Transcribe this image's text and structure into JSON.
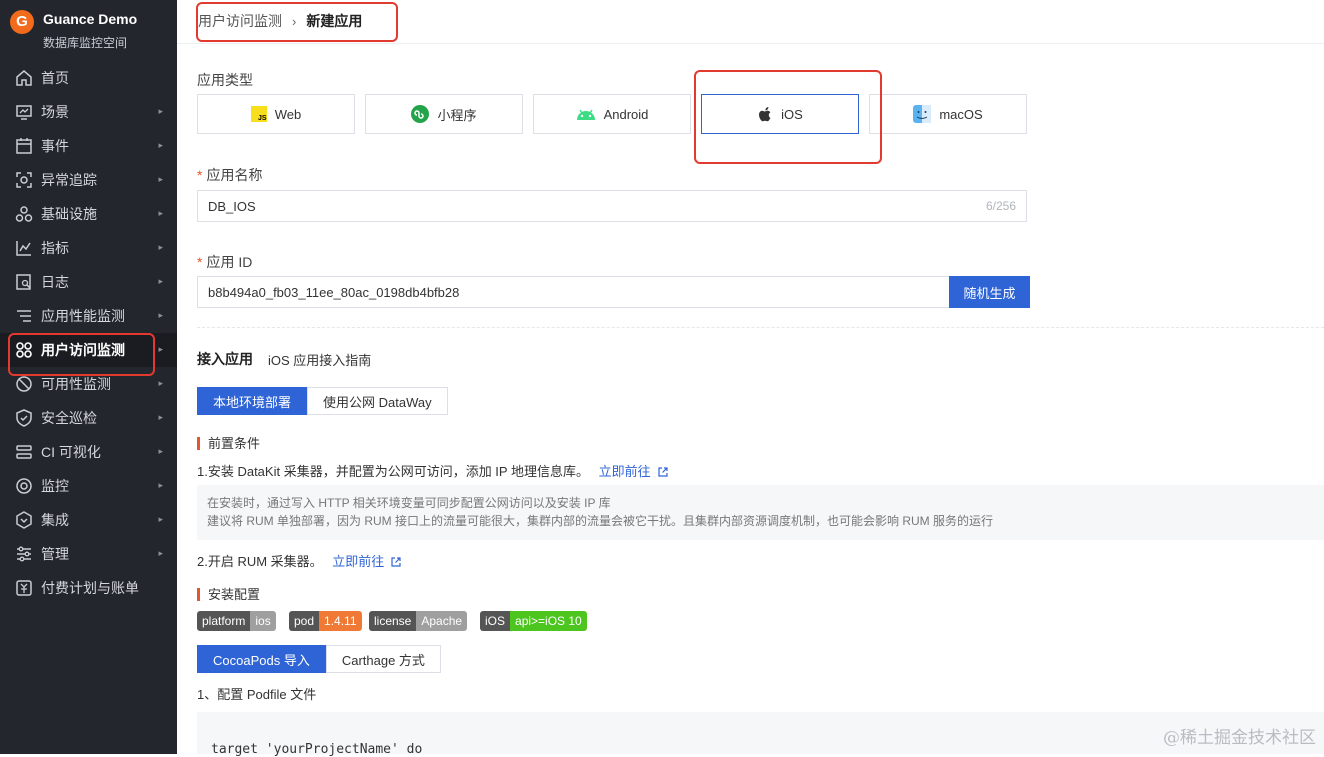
{
  "workspace": {
    "name": "Guance Demo",
    "subtitle": "数据库监控空间",
    "logo_letter": "G"
  },
  "sidebar": {
    "items": [
      {
        "label": "首页",
        "icon": "home-icon",
        "has_submenu": false
      },
      {
        "label": "场景",
        "icon": "dashboard-icon",
        "has_submenu": true
      },
      {
        "label": "事件",
        "icon": "calendar-icon",
        "has_submenu": true
      },
      {
        "label": "异常追踪",
        "icon": "scan-icon",
        "has_submenu": true
      },
      {
        "label": "基础设施",
        "icon": "cluster-icon",
        "has_submenu": true
      },
      {
        "label": "指标",
        "icon": "chart-icon",
        "has_submenu": true
      },
      {
        "label": "日志",
        "icon": "log-icon",
        "has_submenu": true
      },
      {
        "label": "应用性能监测",
        "icon": "apm-icon",
        "has_submenu": true
      },
      {
        "label": "用户访问监测",
        "icon": "grid-icon",
        "has_submenu": true,
        "active": true
      },
      {
        "label": "可用性监测",
        "icon": "gauge-icon",
        "has_submenu": true
      },
      {
        "label": "安全巡检",
        "icon": "shield-icon",
        "has_submenu": true
      },
      {
        "label": "CI 可视化",
        "icon": "ci-icon",
        "has_submenu": true
      },
      {
        "label": "监控",
        "icon": "monitor-icon",
        "has_submenu": true
      },
      {
        "label": "集成",
        "icon": "integration-icon",
        "has_submenu": true
      },
      {
        "label": "管理",
        "icon": "settings-icon",
        "has_submenu": true
      },
      {
        "label": "付费计划与账单",
        "icon": "billing-icon",
        "has_submenu": false
      }
    ]
  },
  "breadcrumb": {
    "parent": "用户访问监测",
    "separator": "›",
    "current": "新建应用"
  },
  "form": {
    "app_type_label": "应用类型",
    "app_types": [
      {
        "label": "Web",
        "icon": "js-icon"
      },
      {
        "label": "小程序",
        "icon": "miniprogram-icon"
      },
      {
        "label": "Android",
        "icon": "android-icon"
      },
      {
        "label": "iOS",
        "icon": "apple-icon",
        "selected": true
      },
      {
        "label": "macOS",
        "icon": "finder-icon"
      }
    ],
    "name_label": "应用名称",
    "name_value": "DB_IOS",
    "name_counter": "6/256",
    "id_label": "应用 ID",
    "id_value": "b8b494a0_fb03_11ee_80ac_0198db4bfb28",
    "random_button": "随机生成",
    "required_mark": "*"
  },
  "access": {
    "title": "接入应用",
    "guide_link": "iOS 应用接入指南",
    "deploy_tabs": [
      "本地环境部署",
      "使用公网 DataWay"
    ],
    "prereq_title": "前置条件",
    "step1": "1.安装 DataKit 采集器，并配置为公网可访问，添加 IP 地理信息库。",
    "goto_link": "立即前往",
    "note_line1": "在安装时，通过写入 HTTP 相关环境变量可同步配置公网访问以及安装 IP 库",
    "note_line2": "建议将 RUM 单独部署，因为 RUM 接口上的流量可能很大，集群内部的流量会被它干扰。且集群内部资源调度机制，也可能会影响 RUM 服务的运行",
    "step2": "2.开启 RUM 采集器。",
    "install_title": "安装配置",
    "badges": [
      {
        "key": "platform",
        "value": "ios",
        "color": "#9f9f9f"
      },
      {
        "key": "pod",
        "value": "1.4.11",
        "color": "#f07a35"
      },
      {
        "key": "license",
        "value": "Apache",
        "color": "#9f9f9f"
      },
      {
        "key": "iOS",
        "value": "api>=iOS 10",
        "color": "#4cc61e"
      }
    ],
    "install_tabs": [
      "CocoaPods 导入",
      "Carthage 方式"
    ],
    "podfile_step": "1、配置 Podfile 文件",
    "code_line": "target 'yourProjectName' do"
  },
  "watermark": "@稀土掘金技术社区",
  "colors": {
    "primary": "#2f64d6",
    "sidebar_bg": "#23262d",
    "highlight": "#e23a2e",
    "accent": "#e4572e"
  }
}
